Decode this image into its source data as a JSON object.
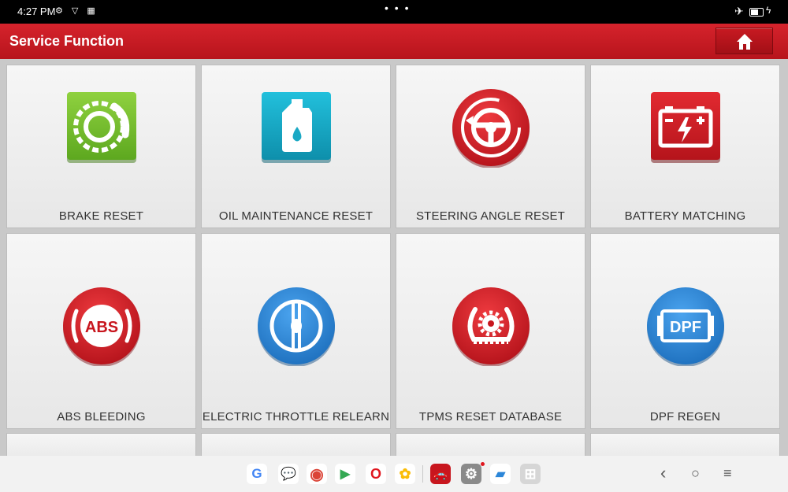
{
  "status_bar": {
    "time": "4:27 PM",
    "indicators": "⚙ ▽ ▦",
    "center_dots": "• • •"
  },
  "header": {
    "title": "Service Function",
    "home_icon": "home-icon",
    "accent_color": "#cc1c24"
  },
  "functions": [
    {
      "label": "BRAKE RESET",
      "icon": "brake-disc-icon",
      "color": "#7cc634"
    },
    {
      "label": "OIL MAINTENANCE RESET",
      "icon": "oil-bottle-icon",
      "color": "#1aa8c4"
    },
    {
      "label": "STEERING ANGLE RESET",
      "icon": "steering-wheel-icon",
      "color": "#d81e25"
    },
    {
      "label": "BATTERY MATCHING",
      "icon": "battery-icon",
      "color": "#d81e25"
    },
    {
      "label": "ABS BLEEDING",
      "icon": "abs-icon",
      "color": "#d81e25",
      "icon_text": "ABS"
    },
    {
      "label": "ELECTRIC THROTTLE RELEARN",
      "icon": "throttle-icon",
      "color": "#2b86d8"
    },
    {
      "label": "TPMS RESET DATABASE",
      "icon": "tpms-icon",
      "color": "#d81e25"
    },
    {
      "label": "DPF REGEN",
      "icon": "dpf-icon",
      "color": "#2b86d8",
      "icon_text": "DPF"
    }
  ],
  "dock": {
    "apps": [
      {
        "name": "google",
        "glyph": "G"
      },
      {
        "name": "messages",
        "glyph": "💬"
      },
      {
        "name": "chrome",
        "glyph": "◉"
      },
      {
        "name": "play-store",
        "glyph": "▶"
      },
      {
        "name": "opera",
        "glyph": "O"
      },
      {
        "name": "photos",
        "glyph": "✿"
      },
      {
        "name": "launch-diagnostic",
        "glyph": "🚗"
      },
      {
        "name": "settings",
        "glyph": "⚙"
      },
      {
        "name": "gallery",
        "glyph": "▰"
      },
      {
        "name": "app-drawer",
        "glyph": "⊞"
      }
    ],
    "nav": {
      "back": "‹",
      "home": "○",
      "recents": "≡"
    }
  }
}
